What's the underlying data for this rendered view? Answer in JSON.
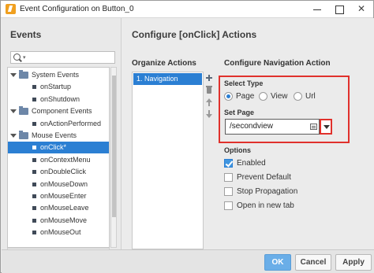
{
  "window": {
    "title": "Event Configuration on Button_0"
  },
  "events_panel": {
    "title": "Events",
    "search": {
      "value": "",
      "placeholder": ""
    },
    "tree": [
      {
        "label": "System Events",
        "kind": "folder",
        "expanded": true
      },
      {
        "label": "onStartup",
        "kind": "leaf"
      },
      {
        "label": "onShutdown",
        "kind": "leaf"
      },
      {
        "label": "Component Events",
        "kind": "folder",
        "expanded": true
      },
      {
        "label": "onActionPerformed",
        "kind": "leaf"
      },
      {
        "label": "Mouse Events",
        "kind": "folder",
        "expanded": true
      },
      {
        "label": "onClick*",
        "kind": "leaf",
        "selected": true
      },
      {
        "label": "onContextMenu",
        "kind": "leaf"
      },
      {
        "label": "onDoubleClick",
        "kind": "leaf"
      },
      {
        "label": "onMouseDown",
        "kind": "leaf"
      },
      {
        "label": "onMouseEnter",
        "kind": "leaf"
      },
      {
        "label": "onMouseLeave",
        "kind": "leaf"
      },
      {
        "label": "onMouseMove",
        "kind": "leaf"
      },
      {
        "label": "onMouseOut",
        "kind": "leaf"
      }
    ]
  },
  "actions_panel": {
    "title": "Configure [onClick] Actions",
    "organize_title": "Organize Actions",
    "actions": [
      {
        "label": "1. Navigation",
        "selected": true
      }
    ],
    "tools": {
      "add": "plus-icon",
      "delete": "trash-icon",
      "move_up": "arrow-up-icon",
      "move_down": "arrow-down-icon"
    }
  },
  "navigation": {
    "title": "Configure Navigation Action",
    "select_type_label": "Select Type",
    "types": [
      {
        "label": "Page",
        "checked": true
      },
      {
        "label": "View",
        "checked": false
      },
      {
        "label": "Url",
        "checked": false
      }
    ],
    "set_page_label": "Set Page",
    "page_value": "/secondview",
    "highlight_color": "#e0312c"
  },
  "options": {
    "title": "Options",
    "items": [
      {
        "label": "Enabled",
        "checked": true
      },
      {
        "label": "Prevent Default",
        "checked": false
      },
      {
        "label": "Stop Propagation",
        "checked": false
      },
      {
        "label": "Open in new tab",
        "checked": false
      }
    ]
  },
  "footer": {
    "ok": "OK",
    "cancel": "Cancel",
    "apply": "Apply"
  },
  "colors": {
    "accent": "#2b7fd3",
    "ok_button": "#6aaee8"
  }
}
